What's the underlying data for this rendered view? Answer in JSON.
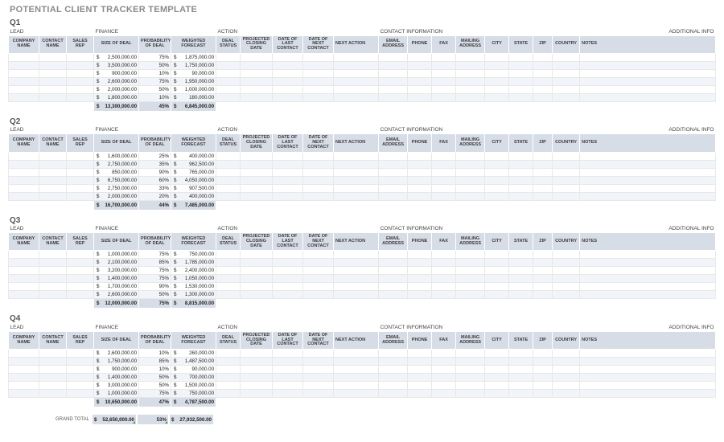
{
  "title": "POTENTIAL CLIENT TRACKER TEMPLATE",
  "section_labels": {
    "lead": "LEAD",
    "finance": "FINANCE",
    "action": "ACTION",
    "contact": "CONTACT INFORMATION",
    "additional": "ADDITIONAL INFO"
  },
  "columns": {
    "company": "COMPANY NAME",
    "contact": "CONTACT NAME",
    "rep": "SALES REP",
    "size": "SIZE OF DEAL",
    "prob": "PROBABILITY OF DEAL",
    "fcst": "WEIGHTED FORECAST",
    "status": "DEAL STATUS",
    "close": "PROJECTED CLOSING DATE",
    "last": "DATE OF LAST CONTACT",
    "nextc": "DATE OF NEXT CONTACT",
    "nexta": "NEXT ACTION",
    "email": "EMAIL ADDRESS",
    "phone": "PHONE",
    "fax": "FAX",
    "mail": "MAILING ADDRESS",
    "city": "CITY",
    "state": "STATE",
    "zip": "ZIP",
    "country": "COUNTRY",
    "notes": "NOTES"
  },
  "currency": "$",
  "quarters": [
    {
      "name": "Q1",
      "rows": [
        {
          "size": "2,500,000.00",
          "prob": "75%",
          "fcst": "1,875,000.00"
        },
        {
          "size": "3,500,000.00",
          "prob": "50%",
          "fcst": "1,750,000.00"
        },
        {
          "size": "900,000.00",
          "prob": "10%",
          "fcst": "90,000.00"
        },
        {
          "size": "2,600,000.00",
          "prob": "75%",
          "fcst": "1,950,000.00"
        },
        {
          "size": "2,000,000.00",
          "prob": "50%",
          "fcst": "1,000,000.00"
        },
        {
          "size": "1,800,000.00",
          "prob": "10%",
          "fcst": "180,000.00"
        }
      ],
      "total": {
        "size": "13,300,000.00",
        "prob": "45%",
        "fcst": "6,845,000.00"
      }
    },
    {
      "name": "Q2",
      "rows": [
        {
          "size": "1,600,000.00",
          "prob": "25%",
          "fcst": "400,000.00"
        },
        {
          "size": "2,750,000.00",
          "prob": "35%",
          "fcst": "962,500.00"
        },
        {
          "size": "850,000.00",
          "prob": "90%",
          "fcst": "765,000.00"
        },
        {
          "size": "6,750,000.00",
          "prob": "60%",
          "fcst": "4,050,000.00"
        },
        {
          "size": "2,750,000.00",
          "prob": "33%",
          "fcst": "907,500.00"
        },
        {
          "size": "2,000,000.00",
          "prob": "20%",
          "fcst": "400,000.00"
        }
      ],
      "total": {
        "size": "16,700,000.00",
        "prob": "44%",
        "fcst": "7,485,000.00"
      }
    },
    {
      "name": "Q3",
      "rows": [
        {
          "size": "1,000,000.00",
          "prob": "75%",
          "fcst": "750,000.00"
        },
        {
          "size": "2,100,000.00",
          "prob": "85%",
          "fcst": "1,785,000.00"
        },
        {
          "size": "3,200,000.00",
          "prob": "75%",
          "fcst": "2,400,000.00"
        },
        {
          "size": "1,400,000.00",
          "prob": "75%",
          "fcst": "1,050,000.00"
        },
        {
          "size": "1,700,000.00",
          "prob": "90%",
          "fcst": "1,530,000.00"
        },
        {
          "size": "2,600,000.00",
          "prob": "50%",
          "fcst": "1,300,000.00"
        }
      ],
      "total": {
        "size": "12,000,000.00",
        "prob": "75%",
        "fcst": "8,815,000.00"
      }
    },
    {
      "name": "Q4",
      "rows": [
        {
          "size": "2,600,000.00",
          "prob": "10%",
          "fcst": "260,000.00"
        },
        {
          "size": "1,750,000.00",
          "prob": "85%",
          "fcst": "1,487,500.00"
        },
        {
          "size": "900,000.00",
          "prob": "10%",
          "fcst": "90,000.00"
        },
        {
          "size": "1,400,000.00",
          "prob": "50%",
          "fcst": "700,000.00"
        },
        {
          "size": "3,000,000.00",
          "prob": "50%",
          "fcst": "1,500,000.00"
        },
        {
          "size": "1,000,000.00",
          "prob": "75%",
          "fcst": "750,000.00"
        }
      ],
      "total": {
        "size": "10,650,000.00",
        "prob": "47%",
        "fcst": "4,787,500.00"
      }
    }
  ],
  "grand": {
    "label": "GRAND TOTAL",
    "size": "52,650,000.00",
    "prob": "53%",
    "fcst": "27,932,500.00"
  }
}
